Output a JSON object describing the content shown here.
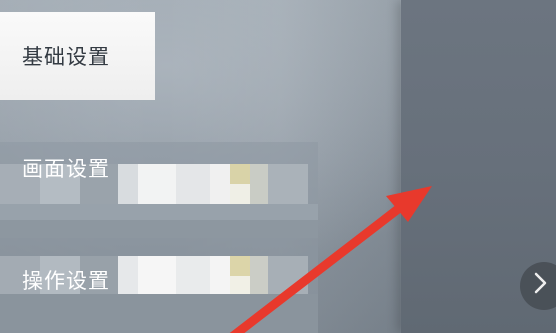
{
  "menu": {
    "items": [
      {
        "label": "基础设置",
        "active": true
      },
      {
        "label": "画面设置",
        "active": false
      },
      {
        "label": "操作设置",
        "active": false
      }
    ]
  },
  "icons": {
    "next": "chevron-right-icon",
    "annotation": "red-arrow-annotation"
  },
  "colors": {
    "menu_bg": "#67707b",
    "active_item_bg": "#f4f4f4",
    "active_item_text": "#333a42",
    "item_text": "#ffffff",
    "annotation_arrow": "#e8392c"
  }
}
